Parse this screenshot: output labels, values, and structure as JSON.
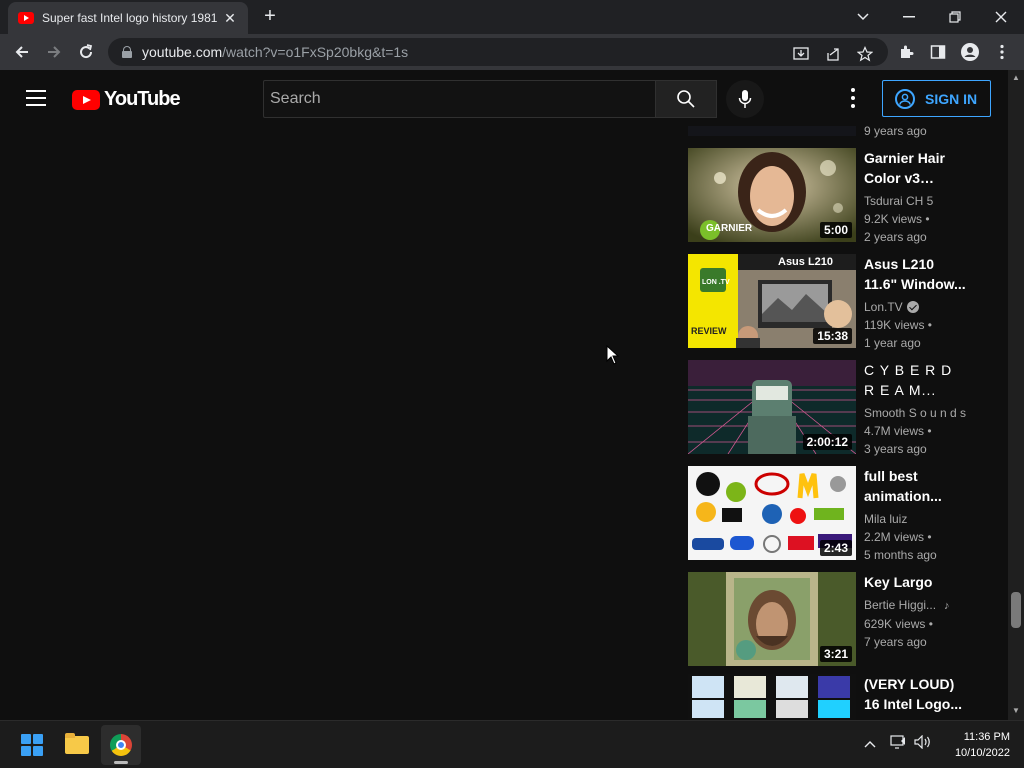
{
  "browser": {
    "tab_title": "Super fast Intel logo history 1981",
    "tab_close": "✕",
    "new_tab": "+",
    "url_host": "youtube.com",
    "url_path": "/watch?v=o1FxSp20bkg&t=1s"
  },
  "youtube": {
    "brand": "YouTube",
    "search_placeholder": "Search",
    "signin_label": "SIGN IN",
    "top_item_age": "9 years ago",
    "related": [
      {
        "title": "Garnier Hair Color v3 Logo...",
        "channel": "Tsdurai CH 5",
        "views": "9.2K views •",
        "age": "2 years ago",
        "duration": "5:00",
        "thumb_text": "GARNIER"
      },
      {
        "title": "Asus L210 11.6\" Window...",
        "channel": "Lon.TV",
        "verified": true,
        "views": "119K views •",
        "age": "1 year ago",
        "duration": "15:38",
        "thumb_text": "Asus L210",
        "thumb_badge": "LON .TV",
        "thumb_review": "REVIEW"
      },
      {
        "title": "C Y B E R   D R E A M...",
        "channel": "Smooth S o u n d s",
        "views": "4.7M views •",
        "age": "3 years ago",
        "duration": "2:00:12"
      },
      {
        "title": "full best animation...",
        "channel": "Mila luiz",
        "views": "2.2M views •",
        "age": "5 months ago",
        "duration": "2:43"
      },
      {
        "title": "Key Largo",
        "channel": "Bertie Higgi...",
        "views": "629K views •",
        "age": "7 years ago",
        "duration": "3:21",
        "music_note": "♪"
      },
      {
        "title": "(VERY LOUD) 16 Intel Logo...",
        "channel": "",
        "views": "",
        "age": "",
        "duration": ""
      }
    ]
  },
  "taskbar": {
    "time": "11:36 PM",
    "date": "10/10/2022"
  }
}
